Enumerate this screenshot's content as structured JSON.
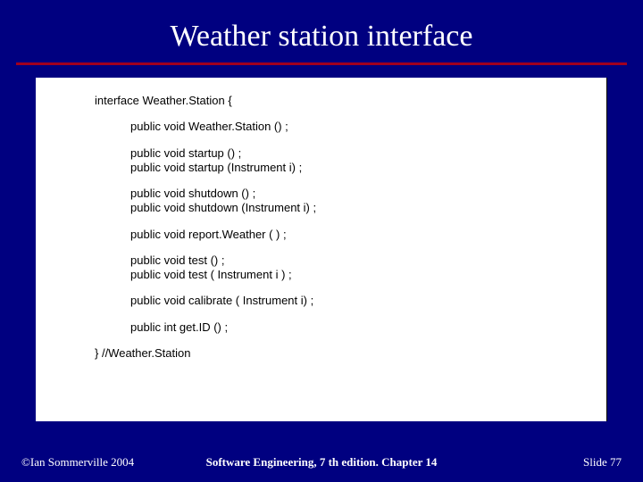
{
  "title": "Weather station interface",
  "code": {
    "open": "interface Weather.Station {",
    "ctor": "public void Weather.Station () ;",
    "startup1": "public void startup () ;",
    "startup2": "public void startup (Instrument i) ;",
    "shutdown1": "public void shutdown () ;",
    "shutdown2": "public void shutdown (Instrument i) ;",
    "report": "public void report.Weather ( ) ;",
    "test1": "public void test () ;",
    "test2": "public void test ( Instrument i ) ;",
    "calibrate": "public void calibrate ( Instrument i) ;",
    "getid": "public int get.ID () ;",
    "close": "} //Weather.Station"
  },
  "footer": {
    "left": "©Ian Sommerville 2004",
    "center": "Software Engineering, 7 th edition. Chapter 14",
    "right": "Slide  77"
  }
}
